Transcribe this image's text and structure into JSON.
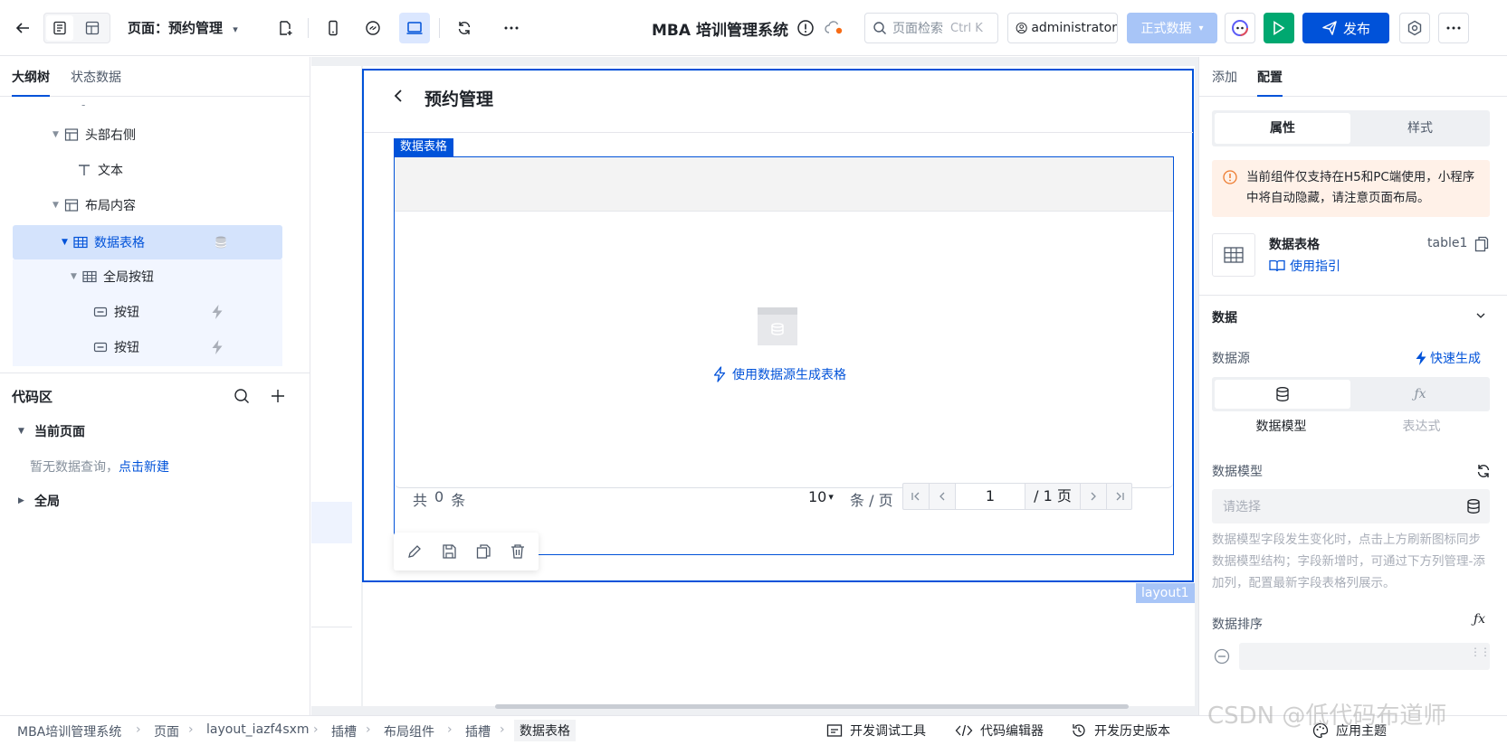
{
  "topbar": {
    "page_selector": "页面：预约管理",
    "app_title": "MBA 培训管理系统",
    "search_placeholder": "页面检索",
    "search_shortcut": "Ctrl K",
    "user": "administrator",
    "env": "正式数据",
    "publish": "发布"
  },
  "left": {
    "tabs": [
      "大纲树",
      "状态数据"
    ],
    "tree": {
      "dash": "-",
      "header_right": "头部右侧",
      "text": "文本",
      "layout_content": "布局内容",
      "data_table": "数据表格",
      "global_buttons": "全局按钮",
      "button1": "按钮",
      "button2": "按钮"
    },
    "code_area": {
      "title": "代码区",
      "current_page": "当前页面",
      "empty_text": "暂无数据查询，",
      "create_link": "点击新建",
      "global": "全局"
    }
  },
  "canvas": {
    "page_title": "预约管理",
    "table_tag": "数据表格",
    "layout_tag": "layout1",
    "generate_link": "使用数据源生成表格",
    "pagination": {
      "total_prefix": "共",
      "total": "0",
      "total_suffix": "条",
      "page_size": "10",
      "per_page": "条 / 页",
      "page": "1",
      "page_total": "/ 1 页"
    }
  },
  "right": {
    "tabs": [
      "添加",
      "配置"
    ],
    "seg": [
      "属性",
      "样式"
    ],
    "notice": "当前组件仅支持在H5和PC端使用，小程序中将自动隐藏，请注意页面布局。",
    "component_name": "数据表格",
    "component_id": "table1",
    "guide": "使用指引",
    "section_data": "数据",
    "datasource_label": "数据源",
    "quick_generate": "快速生成",
    "ds_options": [
      "数据模型",
      "表达式"
    ],
    "model_label": "数据模型",
    "model_placeholder": "请选择",
    "model_help": "数据模型字段发生变化时，点击上方刷新图标同步数据模型结构；字段新增时，可通过下方列管理-添加列，配置最新字段表格列展示。",
    "sort_label": "数据排序"
  },
  "bottom": {
    "breadcrumb": [
      "MBA培训管理系统",
      "页面",
      "layout_iazf4sxm",
      "插槽",
      "布局组件",
      "插槽",
      "数据表格"
    ],
    "tools": [
      "开发调试工具",
      "代码编辑器",
      "开发历史版本",
      "应用主题"
    ]
  },
  "watermark": "CSDN @低代码布道师",
  "colors": {
    "primary": "#0052d9",
    "green": "#00a870",
    "env_btn": "#a8c5f7"
  }
}
